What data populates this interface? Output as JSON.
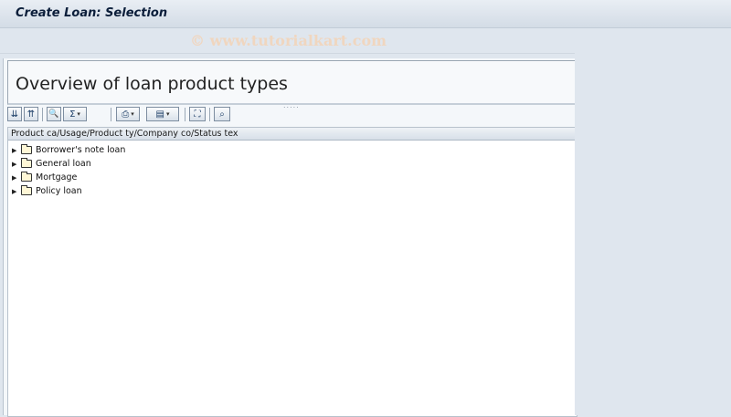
{
  "window": {
    "title": "Create Loan: Selection"
  },
  "watermark": "© www.tutorialkart.com",
  "panel": {
    "heading": "Overview of loan product types"
  },
  "toolbar": {
    "buttons": [
      {
        "icon": "expand-all-icon",
        "glyph": "⇊"
      },
      {
        "icon": "collapse-all-icon",
        "glyph": "⇈"
      },
      {
        "icon": "find-icon",
        "glyph": "🔍"
      },
      {
        "icon": "sum-icon",
        "glyph": "Σ"
      },
      {
        "icon": "print-icon",
        "glyph": "⎙"
      },
      {
        "icon": "layout-icon",
        "glyph": "▤"
      },
      {
        "icon": "hierarchy-icon",
        "glyph": "⛶"
      },
      {
        "icon": "detail-icon",
        "glyph": "⌕"
      }
    ]
  },
  "tree": {
    "column_header": "Product ca/Usage/Product ty/Company co/Status tex",
    "items": [
      {
        "label": "Borrower's note loan"
      },
      {
        "label": "General loan"
      },
      {
        "label": "Mortgage"
      },
      {
        "label": "Policy loan"
      }
    ]
  }
}
